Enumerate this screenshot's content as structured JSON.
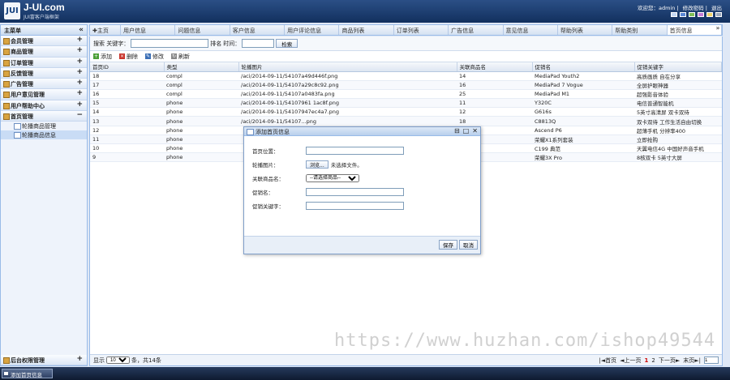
{
  "header": {
    "logo_mark": "JUI",
    "title": "J-UI.com",
    "subtitle": "JUI富客户端框架",
    "welcome": "欢迎您：admin",
    "change_password": "修改密码",
    "logout": "退出",
    "theme_colors": [
      "#c6d9f5",
      "#5b88d6",
      "#7fbf57",
      "#c77dd6",
      "#f0d46a",
      "#9aa8bd"
    ]
  },
  "sidebar": {
    "title": "主菜单",
    "collapse": "«",
    "items": [
      {
        "label": "会员管理",
        "toggle": "+"
      },
      {
        "label": "商品管理",
        "toggle": "+"
      },
      {
        "label": "订单管理",
        "toggle": "+"
      },
      {
        "label": "反馈管理",
        "toggle": "+"
      },
      {
        "label": "广告管理",
        "toggle": "+"
      },
      {
        "label": "用户意见管理",
        "toggle": "+"
      },
      {
        "label": "用户帮助中心",
        "toggle": "+"
      },
      {
        "label": "首页管理",
        "toggle": "−"
      }
    ],
    "sub_items": [
      {
        "label": "轮播商品管理"
      },
      {
        "label": "轮播商品信息"
      }
    ],
    "bottom_item": {
      "label": "后台权限管理",
      "toggle": "+"
    }
  },
  "tabs": [
    {
      "label": "✚主页"
    },
    {
      "label": "用户信息"
    },
    {
      "label": "问题信息"
    },
    {
      "label": "客户信息"
    },
    {
      "label": "用户评论信息"
    },
    {
      "label": "商品列表"
    },
    {
      "label": "订单列表"
    },
    {
      "label": "广告信息"
    },
    {
      "label": "意见信息"
    },
    {
      "label": "帮助列表"
    },
    {
      "label": "帮助类别"
    },
    {
      "label": "首页信息"
    }
  ],
  "tab_more": "»",
  "search": {
    "label": "搜索 关键字：",
    "label2": "排名",
    "label3": "时间：",
    "button": "检索"
  },
  "toolbar": {
    "add": "添加",
    "delete": "删除",
    "edit": "修改",
    "refresh": "刷新"
  },
  "grid": {
    "columns": [
      "首页ID",
      "类型",
      "轮播图片",
      "关联商品名",
      "促销名",
      "促销关键字"
    ],
    "rows": [
      [
        "18",
        "compl",
        "/aci/2014-09-11/54107a49d446f.png",
        "14",
        "MediaPad Youth2",
        "高质画质 自在分享"
      ],
      [
        "17",
        "compl",
        "/aci/2014-09-11/54107a29c8c92.png",
        "16",
        "MediaPad 7 Vogue",
        "全屏护眼神器"
      ],
      [
        "16",
        "compl",
        "/aci/2014-09-11/54107a0483fa.png",
        "25",
        "MediaPad M1",
        "超强影音体验"
      ],
      [
        "15",
        "phone",
        "/aci/2014-09-11/54107961 1ac8f.png",
        "11",
        "Y320C",
        "电信普通智能机"
      ],
      [
        "14",
        "phone",
        "/aci/2014-09-11/54107947ec4a7.png",
        "12",
        "G616s",
        "5英寸高清屏 双卡双待"
      ],
      [
        "13",
        "phone",
        "/aci/2014-09-11/54107...png",
        "18",
        "C8813Q",
        "双卡双待 工作生活自由切换"
      ],
      [
        "12",
        "phone",
        "",
        "",
        "Ascend P6",
        "超薄手机 分辨率400"
      ],
      [
        "11",
        "phone",
        "",
        "",
        "荣耀X1系列套装",
        "立即抢购"
      ],
      [
        "10",
        "phone",
        "",
        "",
        "C199 典范",
        "天翼电信4G 中国好声音手机"
      ],
      [
        "9",
        "phone",
        "",
        "",
        "荣耀3X Pro",
        "8核双卡 5英寸大屏"
      ]
    ]
  },
  "pager": {
    "show_label": "显示",
    "page_size": "10",
    "total_label": "条，共14条",
    "first": "|◄首页",
    "prev": "◄上一页",
    "page1": "1",
    "page2": "2",
    "next": "下一页►",
    "last": "末页►|",
    "goto_value": "1"
  },
  "dialog": {
    "title": "添加首页信息",
    "controls": [
      "⊟",
      "□",
      "✕"
    ],
    "fields": [
      {
        "label": "首页位置："
      },
      {
        "label": "轮播图片：",
        "button": "浏览...",
        "status": "未选择文件。"
      },
      {
        "label": "关联商品名：",
        "select_value": "--请选择商品--"
      },
      {
        "label": "促销名："
      },
      {
        "label": "促销关键字："
      }
    ],
    "save": "保存",
    "cancel": "取消"
  },
  "watermark": "https://www.huzhan.com/ishop49544",
  "taskbar": {
    "item": "添加首页信息"
  }
}
